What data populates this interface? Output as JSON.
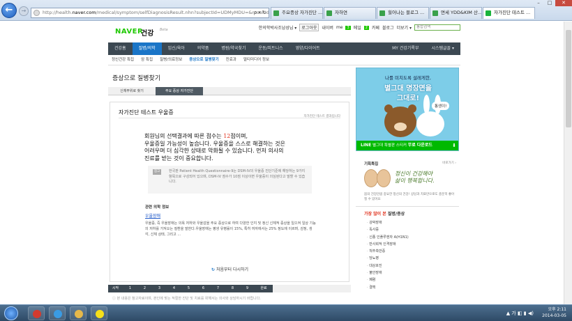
{
  "browser": {
    "address_prefix": "http://health.",
    "address_domain": "naver.com",
    "address_rest": "/medical/symptom/selfDiagnosisResult.nhn?subjectId=UDMyMDU=&resultId=bGFzdA==",
    "address_tools": "ρ ▾ ↻",
    "back_glyph": "←",
    "forward_glyph": "→",
    "tabs": [
      {
        "label": "주요증상 자가진단 ...",
        "active": false
      },
      {
        "label": "자하연",
        "active": false
      },
      {
        "label": "힐어나는 블로그 ...",
        "active": false
      },
      {
        "label": "면세 YDD&KIM 산...",
        "active": false
      },
      {
        "label": "자가진단 테스트 ...",
        "active": true
      }
    ]
  },
  "header": {
    "logo": "NAVER",
    "service": "건강",
    "beta": "Beta",
    "links": {
      "dict": "한의학박사조남성님 ▾",
      "logout": "로그아웃",
      "my": "내이버",
      "me": "me",
      "me_count": "3",
      "mail": "메일",
      "mail_count": "2",
      "cafe": "카페",
      "blog": "블로그",
      "more": "더보기 ▾",
      "search_placeholder": "통합검색"
    }
  },
  "gnb": {
    "items": [
      "건강홈",
      "질병/의학",
      "임신/육아",
      "의약품",
      "병원/약국찾기",
      "운동/피트니스",
      "영양/다이어트"
    ],
    "active": 1,
    "right_items": [
      "MY 건강기록부",
      "시스템글꼴 ▾"
    ]
  },
  "lnb": {
    "items": [
      "정신건강 특집",
      "암 특집",
      "질병/의료정보",
      "증상으로 질병찾기",
      "진료과",
      "멀티미디어 정보"
    ],
    "active": 3
  },
  "content": {
    "section_title": "증상으로 질병찾기",
    "sub_tabs": [
      "신체부위로 찾기",
      "주요 증상 자가진단"
    ],
    "sub_tab_active": 1,
    "test_title": "자가진단 테스트 우울증",
    "test_right": "자가진단 테스트 결과입니다",
    "result_pre": "회원님의 선택결과에 따른 점수는 ",
    "result_score": "12",
    "result_post": "점이며,",
    "result_line2": "우울증일 가능성이 높습니다. 우울증을 스스로 해결하는 것은",
    "result_line3": "어려우며 더 심각한 상태로 악화될 수 있습니다. 먼저 의사의",
    "result_line4": "진료를 받는 것이 중요합니다.",
    "note_badge": "참고",
    "note_text": "한국판 Patient Health Questionnaire-9는 DSM-IV의 우울증 진단기준에 해당하는 9가지 항목으로 구성되어 있으며, DSM-IV 점수가 10점 이상이면 우울증이 의심된다고 말할 수 있습니다.",
    "related_title": "관련 의학 정보",
    "related_link": "우울장애",
    "related_desc": "우울증, 즉 우울장애는 의욕 저하와 우울감을 주요 증상으로 하여 다양한 인지 및 정신 신체적 증상을 일으켜 일상 기능의 저하를 가져오는 질환을 말한다.우울장애는 평생 유병률이 15%, 특히 여자에서는 25% 정도에 이르며, 감정, 생각, 신체 상태, 그리고 ...",
    "retry_icon": "↻",
    "retry_label": "처음부터 다시하기",
    "steps": [
      "시작",
      "1",
      "2",
      "3",
      "4",
      "5",
      "6",
      "7",
      "8",
      "9",
      "완료"
    ],
    "bottom_note": "ⓘ 본 내용은 참고자료이며, 본인에 맞는 적절한 진단 및 치료를 위해서는 의사와 상담하시기 바랍니다."
  },
  "aside": {
    "ad_line1": "나를 미치도록 설레게한,",
    "ad_line2": "별그대 명장면을",
    "ad_line3": "그대로!",
    "ad_speech": "통생이!",
    "ad_bar_brand": "LINE",
    "ad_bar_text": "별그대 특별판 스티커",
    "ad_bar_cta": "무료 다운로드",
    "ad_dl_icon": "⬇",
    "featured_title": "기획특집",
    "featured_more": "바로가기 ›",
    "featured_hand1": "정신이 건강해야",
    "featured_hand2": "삶이 행복합니다.",
    "featured_desc": "몸의 건강만큼 중요한 정신의 건강! 상담과 치료만으로도 충분히 좋아질 수 있어요",
    "popular_title_red": "가장 많이 본",
    "popular_title": " 질병/증상",
    "popular": [
      "강박장애",
      "독사증",
      "신종 인플루엔자 A(H1N1)",
      "반사회적 인격장애",
      "척추측만증",
      "당뇨병",
      "대상포진",
      "불안장애",
      "폐렴",
      "결핵"
    ]
  },
  "taskbar": {
    "time": "오후 2:11",
    "date": "2014-03-05",
    "tray": "▲ 가 ◧ ▮ ◀)"
  }
}
